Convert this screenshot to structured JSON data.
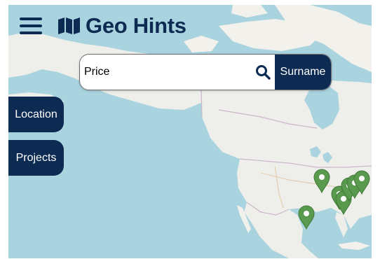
{
  "header": {
    "menu_icon": "hamburger-menu-icon",
    "logo_icon": "folded-map-icon",
    "title": "Geo Hints"
  },
  "search": {
    "placeholder": "Price",
    "value": "",
    "search_icon": "magnifier-icon",
    "button_label": "Surname"
  },
  "side_buttons": [
    {
      "label": "Location"
    },
    {
      "label": "Projects"
    }
  ],
  "map": {
    "marker_icon": "map-pin-icon",
    "marker_color": "#5a9a4e",
    "marker_count": 7
  },
  "colors": {
    "brand": "#0d2b52",
    "water": "#a9d3df",
    "land": "#eeeeea"
  }
}
